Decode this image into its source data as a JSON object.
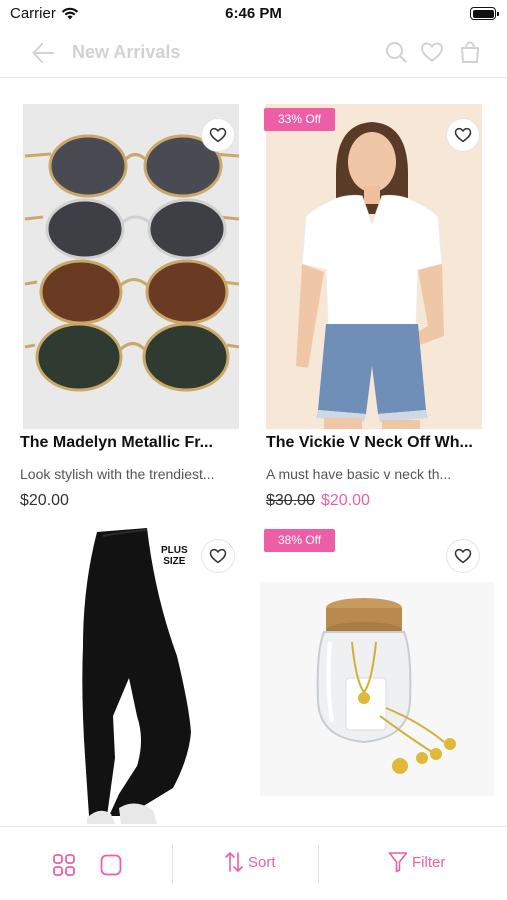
{
  "status_bar": {
    "carrier": "Carrier",
    "time": "6:46 PM"
  },
  "nav": {
    "title": "New Arrivals"
  },
  "products": [
    {
      "title": "The Madelyn Metallic Fr...",
      "description": "Look stylish with the trendiest...",
      "price": "$20.00",
      "image": "sunglasses-photo"
    },
    {
      "badge": "33% Off",
      "title": "The Vickie V Neck Off Wh...",
      "description": "A must have basic v neck th...",
      "old_price": "$30.00",
      "price": "$20.00",
      "image": "white-v-neck-top-photo"
    },
    {
      "tag": "PLUS SIZE",
      "image": "black-leggings-photo"
    },
    {
      "badge": "38% Off",
      "image": "jar-necklace-photo"
    }
  ],
  "bottom_bar": {
    "sort_label": "Sort",
    "filter_label": "Filter"
  },
  "colors": {
    "accent": "#ee5ea6",
    "muted": "#d2d2d2"
  }
}
